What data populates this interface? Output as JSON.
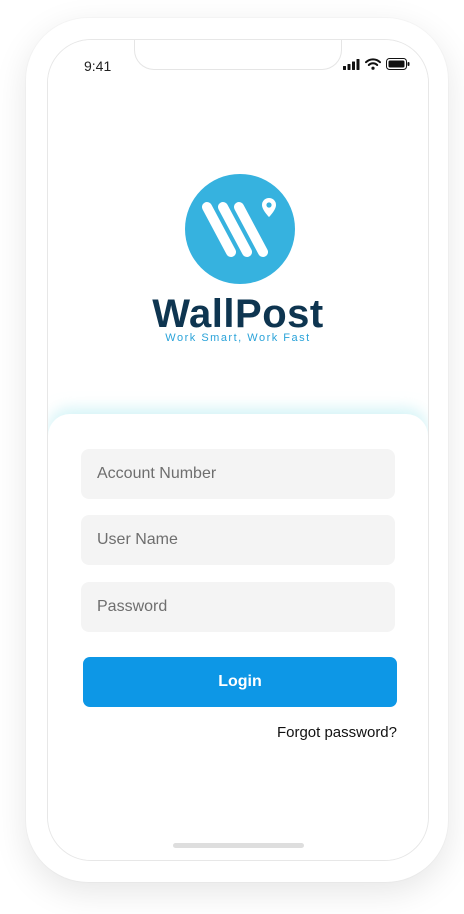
{
  "status_bar": {
    "time": "9:41",
    "icons": [
      "signal-icon",
      "wifi-icon",
      "battery-icon"
    ]
  },
  "brand": {
    "name": "WallPost",
    "tagline": "Work Smart, Work Fast",
    "logo_icon": "wallpost-logo-icon",
    "logo_color": "#36b2df",
    "name_color": "#0e3550"
  },
  "login_form": {
    "account_number": {
      "placeholder": "Account Number",
      "value": ""
    },
    "user_name": {
      "placeholder": "User Name",
      "value": ""
    },
    "password": {
      "placeholder": "Password",
      "value": ""
    },
    "login_button_label": "Login",
    "forgot_password_label": "Forgot password?",
    "accent_color": "#0d97e6"
  }
}
